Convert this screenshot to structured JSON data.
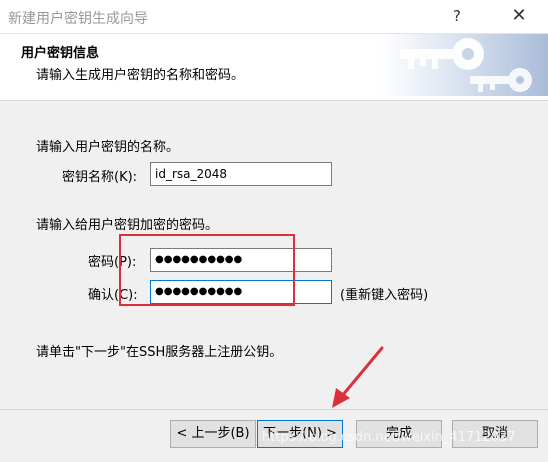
{
  "window": {
    "title": "新建用户密钥生成向导",
    "help": "?",
    "close": "✕"
  },
  "header": {
    "title": "用户密钥信息",
    "subtitle": "请输入生成用户密钥的名称和密码。"
  },
  "name_section": {
    "prompt": "请输入用户密钥的名称。",
    "label": "密钥名称(K):",
    "value": "id_rsa_2048"
  },
  "password_section": {
    "prompt": "请输入给用户密钥加密的密码。",
    "password_label": "密码(P):",
    "password_mask": "●●●●●●●●●●",
    "confirm_label": "确认(C):",
    "confirm_mask": "●●●●●●●●●●",
    "confirm_hint": "(重新键入密码)"
  },
  "instruction": "请单击\"下一步\"在SSH服务器上注册公钥。",
  "buttons": {
    "back": "< 上一步(B)",
    "next": "下一步(N) >",
    "finish": "完成",
    "cancel": "取消"
  },
  "watermark": "https://blog.csdn.net/weixin_41712037",
  "colors": {
    "annotation_box": "#d9303b",
    "annotation_arrow": "#d9303b",
    "focus": "#0078d7"
  }
}
